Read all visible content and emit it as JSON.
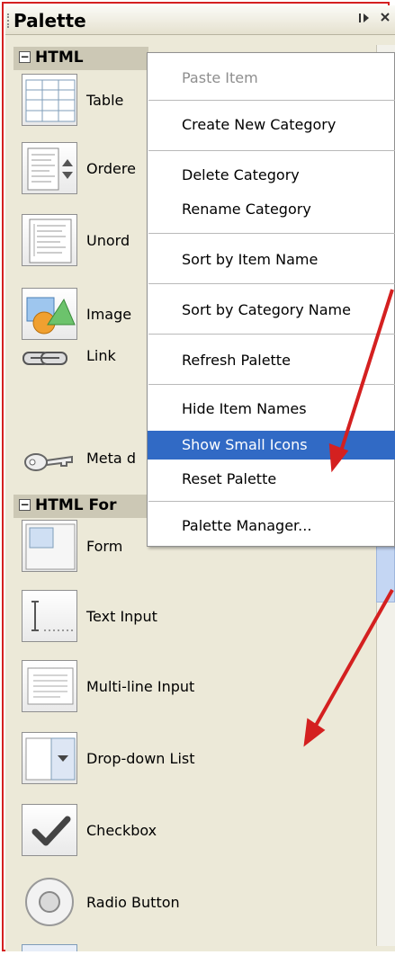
{
  "palette": {
    "title": "Palette",
    "dock_icon": "dock-icon",
    "close_icon": "close-icon"
  },
  "categories": [
    {
      "label": "HTML",
      "expanded": true
    },
    {
      "label": "HTML For",
      "expanded": true
    }
  ],
  "html_items": [
    {
      "label": "Table",
      "icon": "table-icon"
    },
    {
      "label": "Ordere",
      "icon": "ordered-list-icon"
    },
    {
      "label": "Unord",
      "icon": "unordered-list-icon"
    },
    {
      "label": "Image",
      "icon": "image-icon"
    },
    {
      "label": "Link",
      "icon": "link-icon"
    },
    {
      "label": "Meta d",
      "icon": "key-icon"
    }
  ],
  "form_items": [
    {
      "label": "Form",
      "icon": "form-icon"
    },
    {
      "label": "Text Input",
      "icon": "text-input-icon"
    },
    {
      "label": "Multi-line Input",
      "icon": "multiline-input-icon"
    },
    {
      "label": "Drop-down List",
      "icon": "dropdown-list-icon"
    },
    {
      "label": "Checkbox",
      "icon": "checkbox-icon"
    },
    {
      "label": "Radio Button",
      "icon": "radio-button-icon"
    }
  ],
  "context_menu": {
    "items": [
      {
        "label": "Paste Item",
        "disabled": true
      },
      {
        "label": "Create New Category"
      },
      {
        "label": "Delete Category"
      },
      {
        "label": "Rename Category"
      },
      {
        "label": "Sort by Item Name"
      },
      {
        "label": "Sort by Category Name"
      },
      {
        "label": "Refresh Palette"
      },
      {
        "label": "Hide Item Names"
      },
      {
        "label": "Show Small Icons",
        "selected": true
      },
      {
        "label": "Reset Palette"
      },
      {
        "label": "Palette Manager..."
      }
    ]
  },
  "colors": {
    "panel_bg": "#ece9d8",
    "category_bg": "#ccc8b5",
    "menu_selection": "#316ac5",
    "annotation_red": "#d42020"
  }
}
